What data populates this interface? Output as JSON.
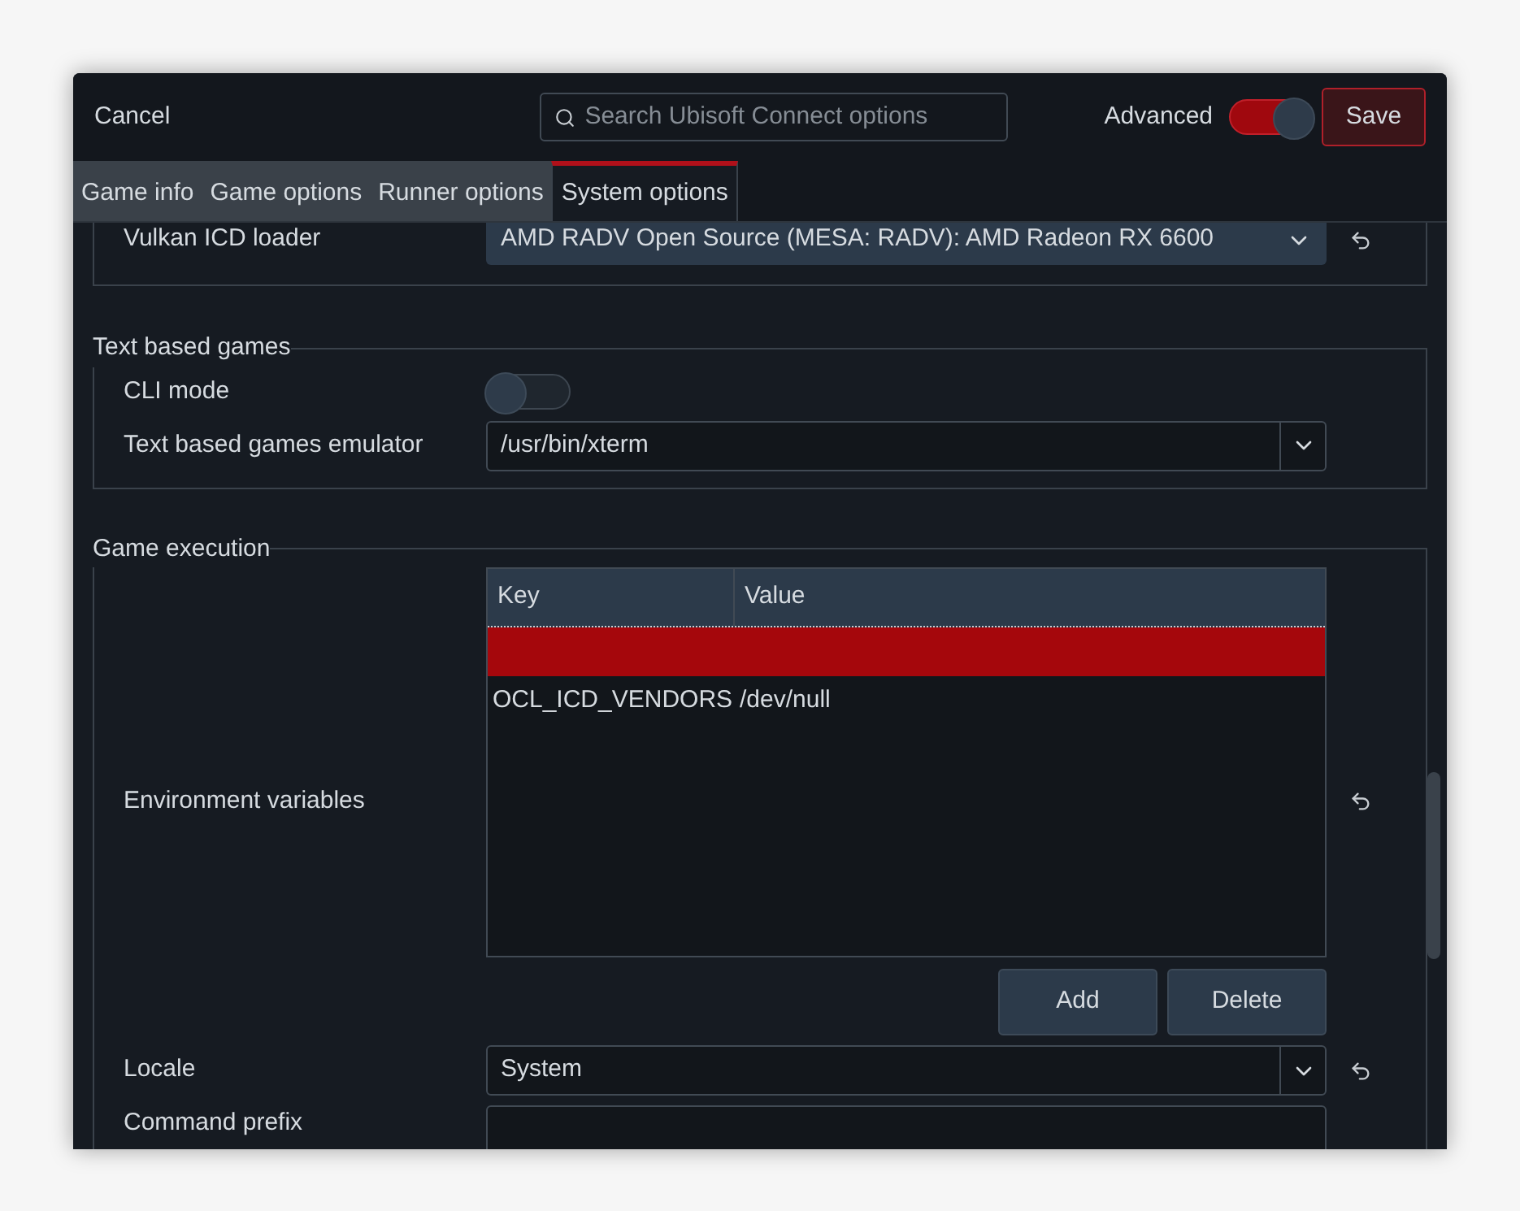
{
  "header": {
    "cancel": "Cancel",
    "search": {
      "placeholder": "Search Ubisoft Connect options"
    },
    "advanced": {
      "label": "Advanced",
      "on": true
    },
    "save": "Save"
  },
  "tabs": [
    {
      "label": "Game info",
      "selected": false
    },
    {
      "label": "Game options",
      "selected": false
    },
    {
      "label": "Runner options",
      "selected": false
    },
    {
      "label": "System options",
      "selected": true
    }
  ],
  "sections": [
    {
      "rows": [
        {
          "kind": "dropdown",
          "label": "Vulkan ICD loader",
          "value": "AMD RADV Open Source (MESA: RADV): AMD Radeon RX 6600",
          "reset": true
        }
      ]
    },
    {
      "title": "Text based games",
      "rows": [
        {
          "kind": "switch",
          "label": "CLI mode",
          "on": false,
          "reset": false
        },
        {
          "kind": "combo",
          "label": "Text based games emulator",
          "value": "/usr/bin/xterm",
          "reset": false
        }
      ]
    },
    {
      "title": "Game execution",
      "rows": [
        {
          "kind": "table",
          "label": "Environment variables",
          "reset": true,
          "columns": [
            "Key",
            "Value"
          ],
          "table_rows": [
            {
              "selected": true
            },
            {
              "key": "OCL_ICD_VENDORS",
              "value": "/dev/null",
              "selected": false
            }
          ],
          "buttons": [
            "Add",
            "Delete"
          ]
        },
        {
          "kind": "combo",
          "label": "Locale",
          "value": "System",
          "reset": true
        },
        {
          "kind": "text",
          "label": "Command prefix",
          "reset": false
        }
      ]
    }
  ]
}
